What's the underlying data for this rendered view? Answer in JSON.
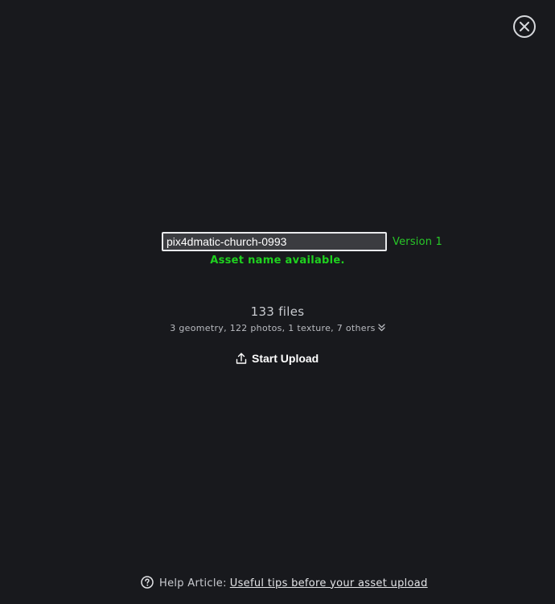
{
  "dialog": {
    "close_icon": "close-icon",
    "asset_name": {
      "value": "pix4dmatic-church-0993",
      "version_label": "Version 1",
      "status": "Asset name available.",
      "status_color": "#1fd11f"
    },
    "files": {
      "count_label": "133 files",
      "breakdown": "3 geometry, 122 photos, 1 texture, 7 others",
      "expand_icon": "double-chevron-down-icon"
    },
    "upload": {
      "icon": "upload-icon",
      "label": "Start Upload"
    },
    "help": {
      "icon": "question-circle-icon",
      "prefix": "Help Article:",
      "link_text": "Useful tips before your asset upload"
    }
  }
}
